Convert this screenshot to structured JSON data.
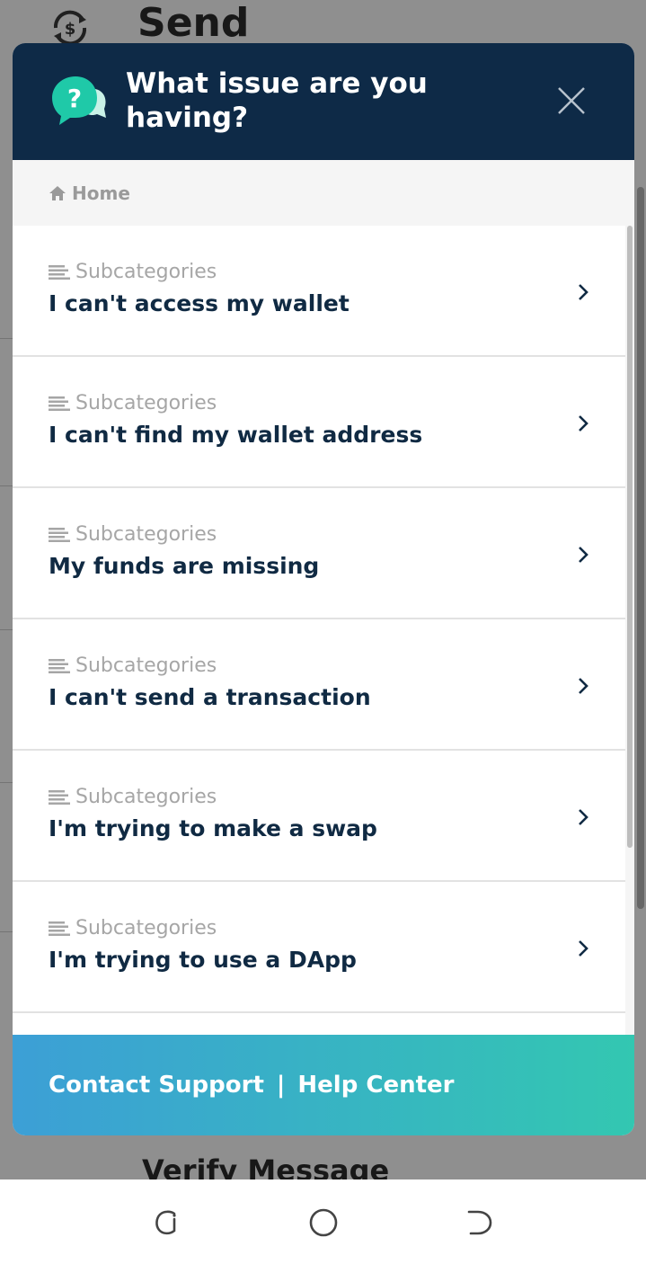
{
  "background": {
    "title": "Send",
    "bottom_text": "Verify Message"
  },
  "modal": {
    "title": "What issue are you having?",
    "breadcrumb": "Home",
    "items": [
      {
        "type": "Subcategories",
        "label": "I can't access my wallet"
      },
      {
        "type": "Subcategories",
        "label": "I can't find my wallet address"
      },
      {
        "type": "Subcategories",
        "label": "My funds are missing"
      },
      {
        "type": "Subcategories",
        "label": "I can't send a transaction"
      },
      {
        "type": "Subcategories",
        "label": "I'm trying to make a swap"
      },
      {
        "type": "Subcategories",
        "label": "I'm trying to use a DApp"
      }
    ],
    "footer": {
      "contact_label": "Contact Support",
      "separator": "|",
      "help_label": "Help Center"
    }
  },
  "icons": {
    "header": "help-chat-icon",
    "close": "close-icon",
    "home": "home-icon",
    "subcategory": "lines-icon",
    "chevron": "chevron-right-icon",
    "nav_recent": "recent-apps-icon",
    "nav_home": "home-circle-icon",
    "nav_back": "back-icon"
  },
  "colors": {
    "header_bg": "#0e2a47",
    "accent_teal": "#1fc9a8",
    "footer_gradient_start": "#3c9fd6",
    "footer_gradient_end": "#33c7b1",
    "item_text": "#102a43"
  }
}
